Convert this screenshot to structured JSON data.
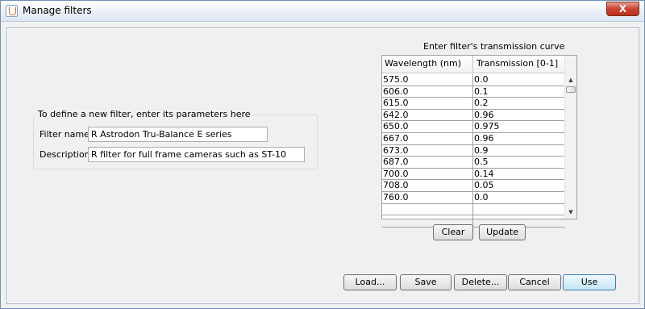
{
  "window": {
    "title": "Manage filters",
    "close_glyph": "X"
  },
  "new_filter": {
    "group_title": "To define a new filter, enter its parameters here",
    "name_label": "Filter name:",
    "name_value": "R Astrodon Tru-Balance E series",
    "description_label": "Description:",
    "description_value": "R filter for full frame cameras such as ST-10"
  },
  "curve": {
    "caption": "Enter filter's transmission curve",
    "columns": [
      "Wavelength (nm)",
      "Transmission [0-1]"
    ],
    "rows": [
      [
        "575.0",
        "0.0"
      ],
      [
        "606.0",
        "0.1"
      ],
      [
        "615.0",
        "0.2"
      ],
      [
        "642.0",
        "0.96"
      ],
      [
        "650.0",
        "0.975"
      ],
      [
        "667.0",
        "0.96"
      ],
      [
        "673.0",
        "0.9"
      ],
      [
        "687.0",
        "0.5"
      ],
      [
        "700.0",
        "0.14"
      ],
      [
        "708.0",
        "0.05"
      ],
      [
        "760.0",
        "0.0"
      ],
      [
        "",
        ""
      ],
      [
        "",
        ""
      ]
    ],
    "clear_label": "Clear",
    "update_label": "Update"
  },
  "actions": {
    "load_label": "Load...",
    "save_label": "Save",
    "delete_label": "Delete...",
    "cancel_label": "Cancel",
    "use_label": "Use"
  }
}
